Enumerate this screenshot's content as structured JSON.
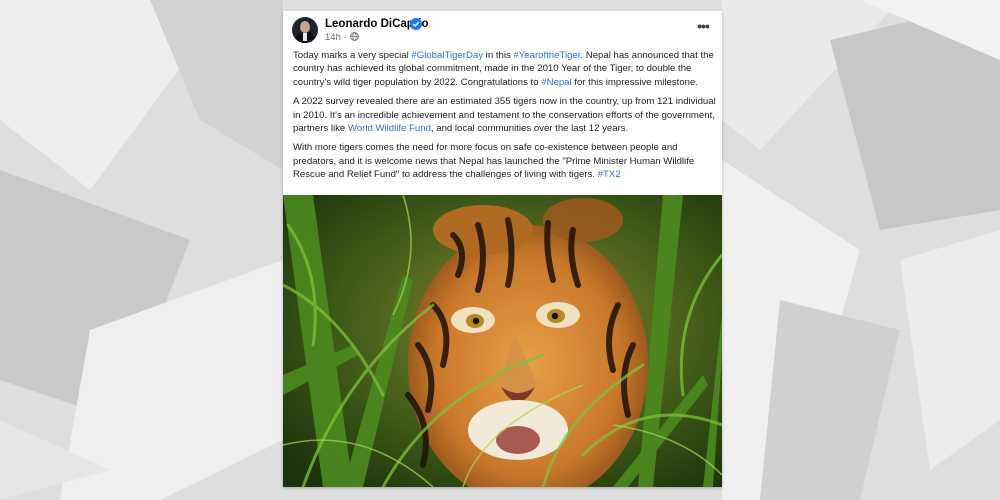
{
  "post": {
    "author": "Leonardo DiCaprio",
    "time": "14h",
    "audience_icon": "globe-icon",
    "more_label": "•••",
    "paragraph1": {
      "t1": "Today marks a very special ",
      "tag1": "#GlobalTigerDay",
      "t2": " in this ",
      "tag2": "#YearoftheTiger",
      "t3": ". Nepal has announced that the country has achieved its global commitment, made in the 2010 Year of the Tiger, to double the country's wild tiger population by 2022. Congratulations to ",
      "tag3": "#Nepal",
      "t4": " for this impressive milestone."
    },
    "paragraph2": {
      "t1": "A 2022 survey revealed there are an estimated 355 tigers now in the country, up from 121 individual in 2010. It's an incredible achievement and testament to the conservation efforts of the government, partners like ",
      "link": "World Wildlife Fund",
      "t2": ", and local communities over the last 12 years."
    },
    "paragraph3": {
      "t1": "With more tigers comes the need for more focus on safe co-existence between people and predators, and it is welcome news that Nepal has launched the \"Prime Minister Human Wildlife Rescue and Relief Fund\" to address the challenges of living with tigers. ",
      "tag": "#TX2"
    },
    "image_subject": "tiger in tall green grass"
  },
  "colors": {
    "link": "#2d6fd6",
    "verified": "#1877f2",
    "text": "#1c1e21",
    "muted": "#65676b"
  }
}
